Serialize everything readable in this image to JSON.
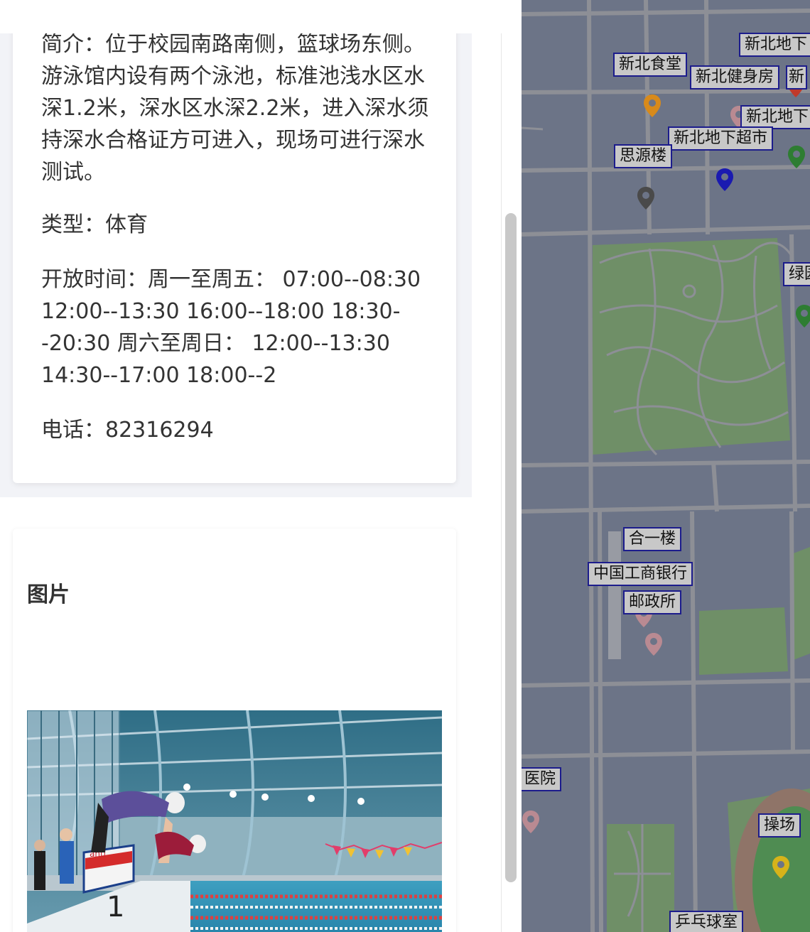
{
  "info": {
    "intro": "简介：位于校园南路南侧，篮球场东侧。游泳馆内设有两个泳池，标准池浅水区水深1.2米，深水区水深2.2米，进入深水须持深水合格证方可进入，现场可进行深水测试。",
    "type": "类型：体育",
    "hours": "开放时间：周一至周五： 07:00--08:30 12:00--13:30 16:00--18:00 18:30--20:30 周六至周日： 12:00--13:30 14:30--17:00 18:00--2",
    "phone": "电话：82316294"
  },
  "gallery": {
    "title": "图片",
    "lane_number": "1",
    "board_brand": "anti"
  },
  "map": {
    "labels": [
      {
        "id": "xinbei-dixia-1",
        "text": "新北地下"
      },
      {
        "id": "xinbei-canteen",
        "text": "新北食堂"
      },
      {
        "id": "xinbei-gym",
        "text": "新北健身房"
      },
      {
        "id": "xinbei-partial",
        "text": "新"
      },
      {
        "id": "xinbei-dixia-2",
        "text": "新北地下"
      },
      {
        "id": "xinbei-supermarket",
        "text": "新北地下超市"
      },
      {
        "id": "siyuan",
        "text": "思源楼"
      },
      {
        "id": "green-partial",
        "text": "绿园"
      },
      {
        "id": "heyi",
        "text": "合一楼"
      },
      {
        "id": "icbc",
        "text": "中国工商银行"
      },
      {
        "id": "post-office",
        "text": "邮政所"
      },
      {
        "id": "hospital",
        "text": "医院"
      },
      {
        "id": "playground",
        "text": "操场"
      },
      {
        "id": "pingpong",
        "text": "乒乓球室"
      }
    ],
    "pin_colors": {
      "orange": "#d88a1a",
      "red": "#c0392b",
      "pink": "#b98a92",
      "green": "#2e7d32",
      "gray": "#4a4a4a",
      "blue": "#1a1ab0",
      "yellow": "#d6b31a"
    }
  }
}
